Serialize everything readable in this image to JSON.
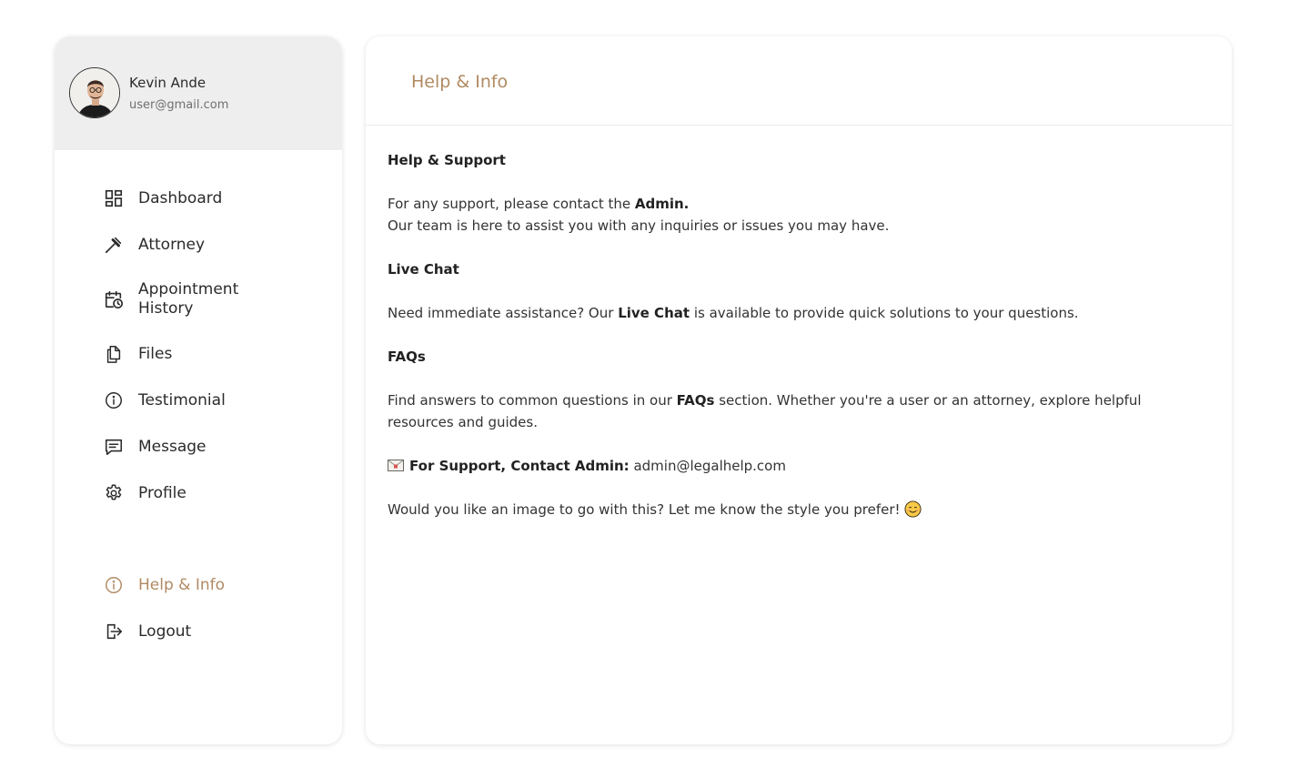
{
  "user": {
    "name": "Kevin Ande",
    "email": "user@gmail.com"
  },
  "nav": {
    "items": [
      {
        "label": "Dashboard",
        "icon": "dashboard-icon"
      },
      {
        "label": "Attorney",
        "icon": "gavel-icon"
      },
      {
        "label": "Appointment History",
        "icon": "calendar-clock-icon"
      },
      {
        "label": "Files",
        "icon": "files-icon"
      },
      {
        "label": "Testimonial",
        "icon": "info-icon"
      },
      {
        "label": "Message",
        "icon": "message-icon"
      },
      {
        "label": "Profile",
        "icon": "gear-icon"
      }
    ],
    "help_label": "Help & Info",
    "logout_label": "Logout"
  },
  "main": {
    "title": "Help & Info",
    "help_heading": "Help & Support",
    "support_prefix": "For any support, please contact the ",
    "support_admin": "Admin.",
    "support_line2": "Our team is here to assist you with any inquiries or issues you may have.",
    "chat_heading": "Live Chat",
    "chat_prefix": "Need immediate assistance? Our ",
    "chat_bold": "Live Chat",
    "chat_suffix": " is available to provide quick solutions to your questions.",
    "faq_heading": "FAQs",
    "faq_prefix": "Find answers to common questions in our ",
    "faq_bold": "FAQs",
    "faq_suffix": " section. Whether you're a user or an attorney, explore helpful resources and guides.",
    "contact_label": "For Support, Contact Admin:",
    "contact_email": " admin@legalhelp.com",
    "closing": "Would you like an image to go with this? Let me know the style you prefer!"
  },
  "colors": {
    "accent": "#b08a63",
    "text": "#2b2b2b",
    "profile_bg": "#eeeeee"
  }
}
